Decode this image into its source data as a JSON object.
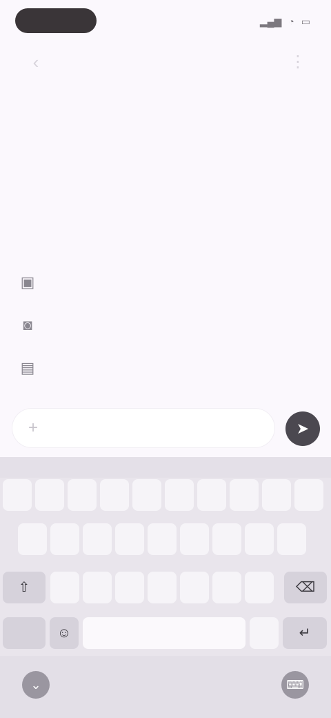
{
  "status_bar": {
    "time": "",
    "icons": [
      "signal-icon",
      "wifi-icon",
      "battery-icon"
    ]
  },
  "top_bar": {
    "tab_title": "",
    "back_icon": "arrow-left-icon",
    "more_icon": "more-vertical-icon"
  },
  "actions": [
    {
      "icon": "image-icon",
      "label": ""
    },
    {
      "icon": "camera-icon",
      "label": ""
    },
    {
      "icon": "file-icon",
      "label": ""
    }
  ],
  "composer": {
    "placeholder": "",
    "value": "",
    "send_icon": "send-icon"
  },
  "keyboard": {
    "row1": [
      "",
      "",
      "",
      "",
      "",
      "",
      "",
      "",
      "",
      ""
    ],
    "row2": [
      "",
      "",
      "",
      "",
      "",
      "",
      "",
      "",
      ""
    ],
    "row3": [
      "",
      "",
      "",
      "",
      "",
      "",
      ""
    ],
    "row4": {
      "left": "",
      "space": "",
      "right": ""
    }
  },
  "colors": {
    "accent": "#4a62d8",
    "background": "#fbf8fd",
    "keyboard": "#e9e5ec",
    "send_button": "#4b4850"
  }
}
